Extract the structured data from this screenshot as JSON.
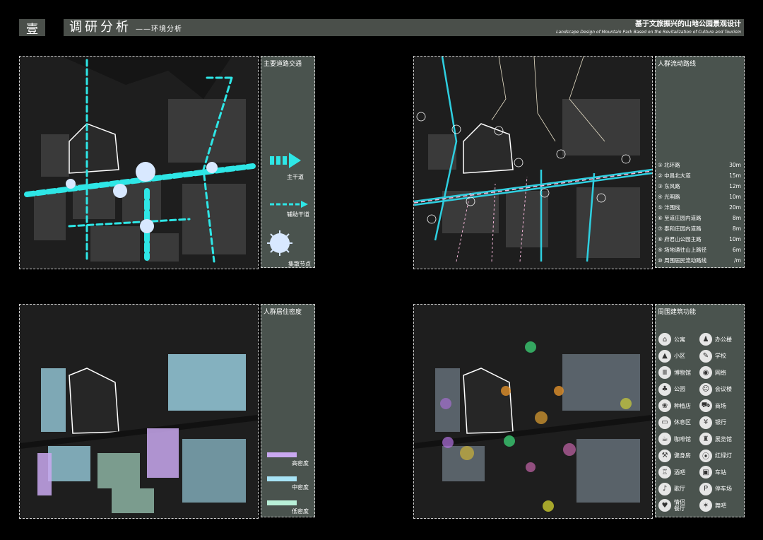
{
  "header": {
    "section_num": "壹",
    "title": "调研分析",
    "subtitle": "——环境分析",
    "cn_project": "基于文旅振兴的山地公园景观设计",
    "en_project": "Landscape Design of Mountain Park Based on the Revitalization of Culture and Tourism"
  },
  "panel_traffic": {
    "title": "主要道路交通",
    "legend": {
      "main_road": "主干道",
      "aux_road": "辅助干道",
      "node": "集散节点"
    }
  },
  "panel_flow": {
    "title": "人群流动路线",
    "roads": [
      {
        "name": "① 北环路",
        "width": "30m"
      },
      {
        "name": "② 中昌北大道",
        "width": "15m"
      },
      {
        "name": "③ 东风路",
        "width": "12m"
      },
      {
        "name": "④ 光明路",
        "width": "10m"
      },
      {
        "name": "⑤ 沣围线",
        "width": "20m"
      },
      {
        "name": "⑥ 至道庄园内道路",
        "width": "8m"
      },
      {
        "name": "⑦ 泰和庄园内道路",
        "width": "8m"
      },
      {
        "name": "⑧ 府君山公园主路",
        "width": "10m"
      },
      {
        "name": "⑨ 场地通往山上路径",
        "width": "6m"
      },
      {
        "name": "⑩ 周围居民流动路线",
        "width": "/m"
      }
    ]
  },
  "panel_density": {
    "title": "人群居住密度",
    "levels": [
      {
        "label": "高密度",
        "color": "#c9a8f0"
      },
      {
        "label": "中密度",
        "color": "#a7e3f5"
      },
      {
        "label": "低密度",
        "color": "#b9f0d8"
      }
    ]
  },
  "panel_function": {
    "title": "周围建筑功能",
    "items": [
      {
        "label": "公寓",
        "icon": "apartment-icon",
        "glyph": "⌂"
      },
      {
        "label": "办公楼",
        "icon": "office-icon",
        "glyph": "♟"
      },
      {
        "label": "小区",
        "icon": "community-icon",
        "glyph": "▲"
      },
      {
        "label": "学校",
        "icon": "school-icon",
        "glyph": "✎"
      },
      {
        "label": "博物馆",
        "icon": "museum-icon",
        "glyph": "Ⅲ"
      },
      {
        "label": "网络",
        "icon": "network-icon",
        "glyph": "◉"
      },
      {
        "label": "公园",
        "icon": "park-icon",
        "glyph": "♣"
      },
      {
        "label": "会议楼",
        "icon": "meeting-icon",
        "glyph": "☺"
      },
      {
        "label": "种植店",
        "icon": "plant-shop-icon",
        "glyph": "❀"
      },
      {
        "label": "商场",
        "icon": "mall-icon",
        "glyph": "⛟"
      },
      {
        "label": "休息区",
        "icon": "rest-area-icon",
        "glyph": "▭"
      },
      {
        "label": "银行",
        "icon": "bank-icon",
        "glyph": "¥"
      },
      {
        "label": "咖啡馆",
        "icon": "cafe-icon",
        "glyph": "☕"
      },
      {
        "label": "展览馆",
        "icon": "exhibition-icon",
        "glyph": "♜"
      },
      {
        "label": "健身房",
        "icon": "gym-icon",
        "glyph": "⚒"
      },
      {
        "label": "红绿灯",
        "icon": "traffic-light-icon",
        "glyph": "⦿"
      },
      {
        "label": "酒吧",
        "icon": "bar-icon",
        "glyph": "♖"
      },
      {
        "label": "车站",
        "icon": "station-icon",
        "glyph": "▣"
      },
      {
        "label": "歌厅",
        "icon": "ktv-icon",
        "glyph": "♪"
      },
      {
        "label": "停车场",
        "icon": "parking-icon",
        "glyph": "P"
      },
      {
        "label": "情侣餐厅",
        "icon": "couple-restaurant-icon",
        "glyph": "♥"
      },
      {
        "label": "舞吧",
        "icon": "dance-bar-icon",
        "glyph": "✶"
      }
    ]
  }
}
